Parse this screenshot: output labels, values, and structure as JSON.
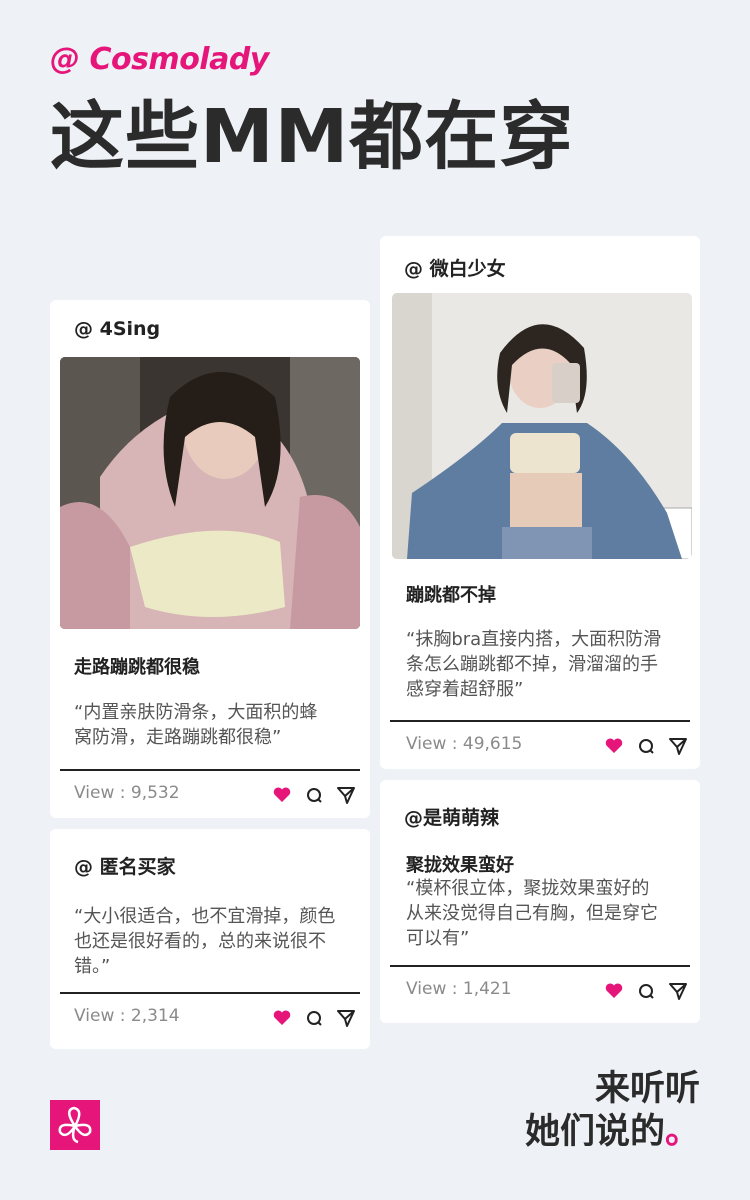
{
  "brand": "@ Cosmolady",
  "headline": "这些MM都在穿",
  "accent_color": "#e5157a",
  "posts": [
    {
      "user": "@ 4Sing",
      "title": "走路蹦跳都很稳",
      "quote_lines": [
        "“内置亲肤防滑条，大面积的蜂",
        "窝防滑，走路蹦跳都很稳”"
      ],
      "views": "View : 9,532"
    },
    {
      "user": "@ 匿名买家",
      "title": "",
      "quote_lines": [
        "“大小很适合，也不宜滑掉，颜色",
        "也还是很好看的，总的来说很不",
        "错。”"
      ],
      "views": "View : 2,314"
    },
    {
      "user": "@ 微白少女",
      "title": "蹦跳都不掉",
      "quote_lines": [
        "“抹胸bra直接内搭，大面积防滑",
        "条怎么蹦跳都不掉，滑溜溜的手",
        "感穿着超舒服”"
      ],
      "views": "View : 49,615"
    },
    {
      "user": "@是萌萌辣",
      "title": "聚拢效果蛮好",
      "quote_lines": [
        "“模杯很立体，聚拢效果蛮好的",
        "从来没觉得自己有胸，但是穿它",
        "可以有”"
      ],
      "views": "View : 1,421"
    }
  ],
  "icons": [
    "heart-icon",
    "comment-icon",
    "share-icon"
  ],
  "tagline": {
    "line1": "来听听",
    "line2": "她们说的",
    "dot": "。"
  },
  "logo_icon": "flower-logo-icon"
}
